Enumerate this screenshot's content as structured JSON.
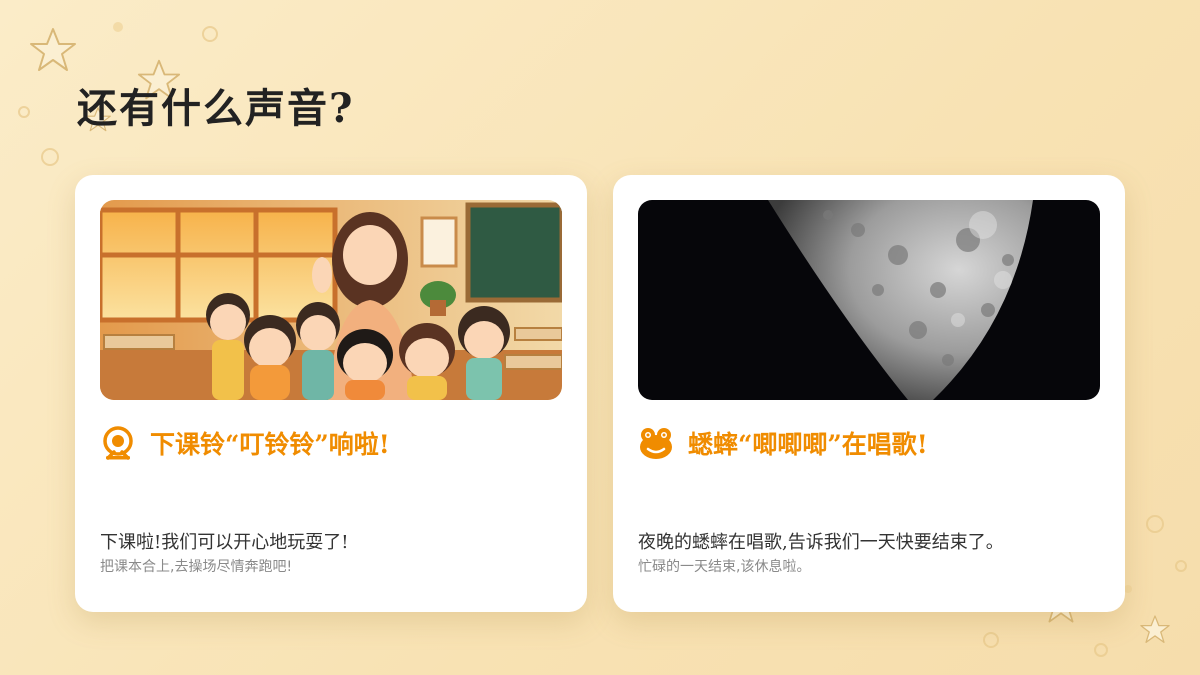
{
  "page": {
    "title": "还有什么声音?"
  },
  "cards": [
    {
      "heading": "下课铃“叮铃铃”响啦!",
      "icon": "bell-icon",
      "description": "下课啦!我们可以开心地玩耍了!",
      "subtext": "把课本合上,去操场尽情奔跑吧!",
      "image": "classroom-illustration"
    },
    {
      "heading": "蟋蟀“唧唧唧”在唱歌!",
      "icon": "frog-icon",
      "description": "夜晚的蟋蟀在唱歌,告诉我们一天快要结束了。",
      "subtext": "忙碌的一天结束,该休息啦。",
      "image": "moon-photo"
    }
  ],
  "colors": {
    "accent": "#f08c00",
    "background": "#f9e6bd",
    "card": "#ffffff"
  }
}
